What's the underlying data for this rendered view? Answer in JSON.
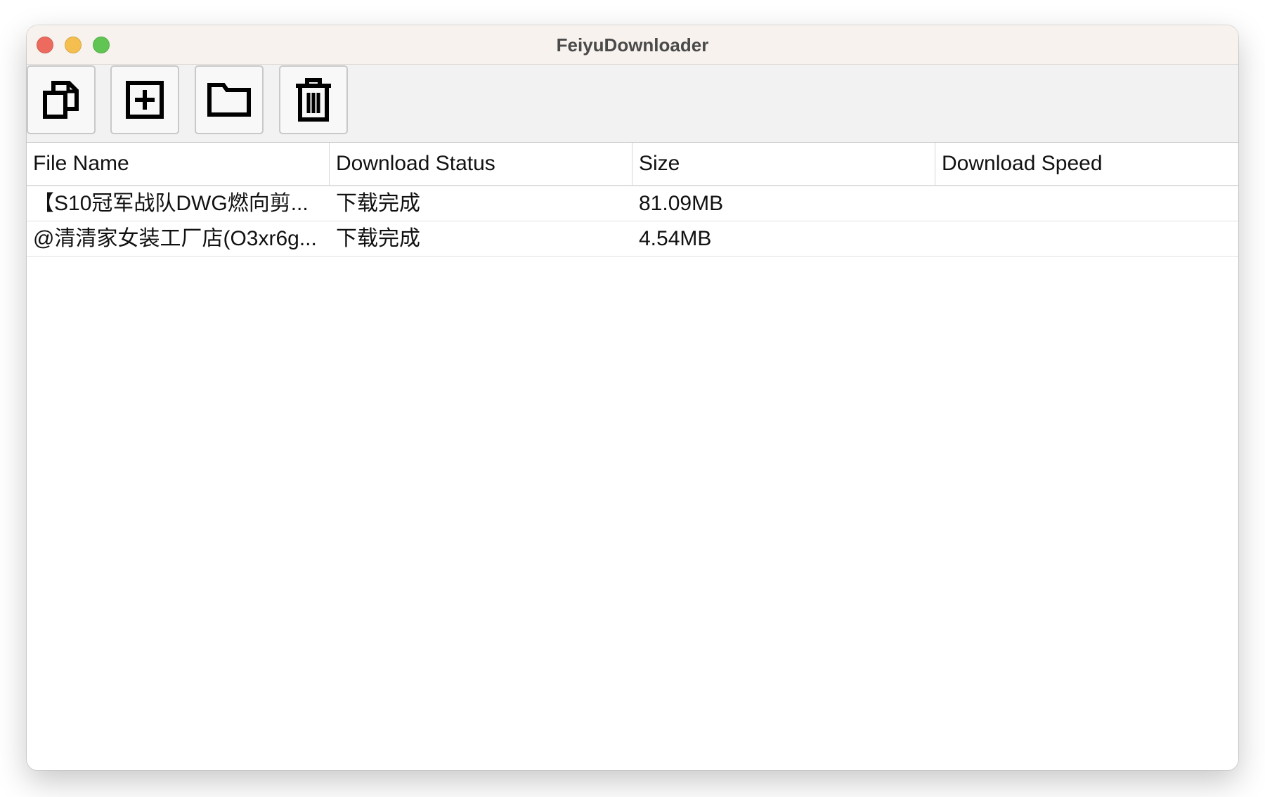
{
  "window": {
    "title": "FeiyuDownloader"
  },
  "window_controls": [
    {
      "name": "close",
      "color": "#ed6a5e"
    },
    {
      "name": "minimize",
      "color": "#f5bf4f"
    },
    {
      "name": "zoom",
      "color": "#61c554"
    }
  ],
  "toolbar": {
    "buttons": [
      {
        "icon": "copy-icon"
      },
      {
        "icon": "add-icon"
      },
      {
        "icon": "folder-icon"
      },
      {
        "icon": "trash-icon"
      }
    ]
  },
  "table": {
    "columns": [
      "File Name",
      "Download Status",
      "Size",
      "Download Speed"
    ],
    "rows": [
      {
        "file_name": "【S10冠军战队DWG燃向剪...",
        "status": "下载完成",
        "size": "81.09MB",
        "speed": ""
      },
      {
        "file_name": "@清清家女装工厂店(O3xr6g...",
        "status": "下载完成",
        "size": "4.54MB",
        "speed": ""
      }
    ]
  },
  "colors": {
    "titlebar": "#f7f2ee",
    "toolbar": "#f2f2f2",
    "table_background": "#ffffff",
    "text": "#111111"
  }
}
